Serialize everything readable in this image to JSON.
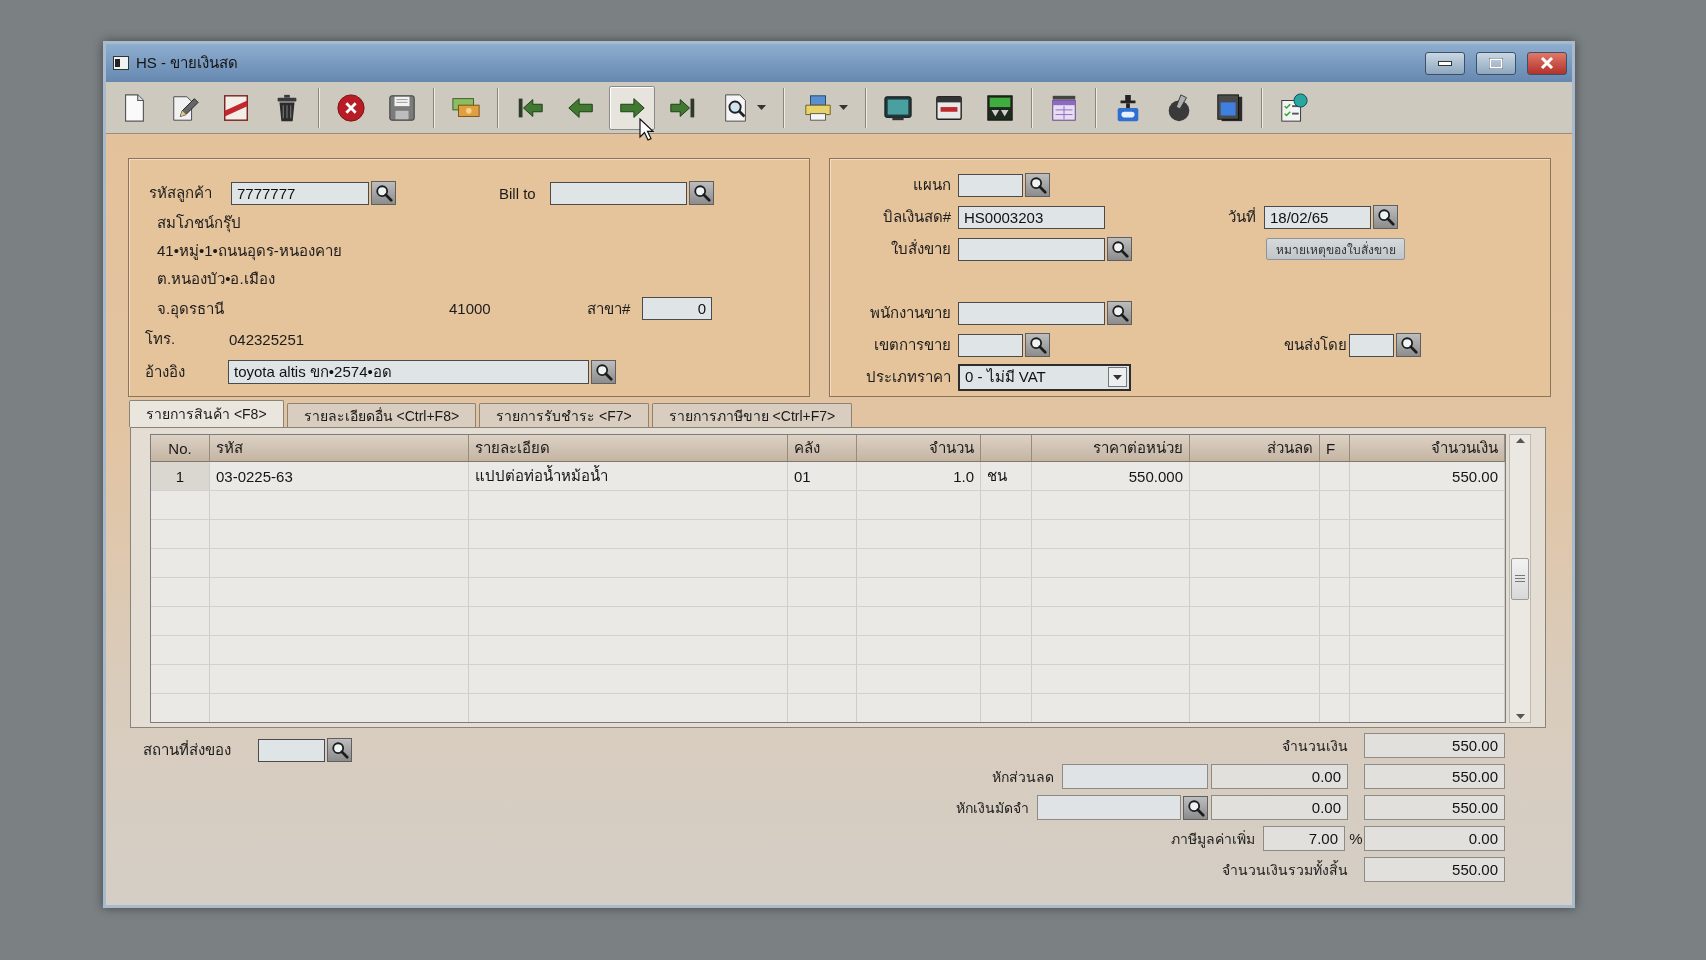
{
  "window": {
    "title": "HS - ขายเงินสด"
  },
  "toolbar": [
    [
      {
        "kind": "new",
        "hover": false,
        "dropdown": false
      },
      {
        "kind": "edit",
        "hover": false,
        "dropdown": false
      },
      {
        "kind": "void",
        "hover": false,
        "dropdown": false
      },
      {
        "kind": "delete",
        "hover": false,
        "dropdown": false
      }
    ],
    [
      {
        "kind": "cancel",
        "hover": false,
        "dropdown": false
      },
      {
        "kind": "save",
        "hover": false,
        "dropdown": false
      }
    ],
    [
      {
        "kind": "payment",
        "hover": false,
        "dropdown": false
      }
    ],
    [
      {
        "kind": "first",
        "hover": false,
        "dropdown": false
      },
      {
        "kind": "previous",
        "hover": false,
        "dropdown": false
      },
      {
        "kind": "next",
        "hover": true,
        "dropdown": false
      },
      {
        "kind": "last",
        "hover": false,
        "dropdown": false
      },
      {
        "kind": "find",
        "hover": false,
        "dropdown": true
      }
    ],
    [
      {
        "kind": "print",
        "hover": false,
        "dropdown": true
      }
    ],
    [
      {
        "kind": "monitor",
        "hover": false,
        "dropdown": false
      },
      {
        "kind": "card",
        "hover": false,
        "dropdown": false
      },
      {
        "kind": "transfer",
        "hover": false,
        "dropdown": false
      }
    ],
    [
      {
        "kind": "calendar",
        "hover": false,
        "dropdown": false
      }
    ],
    [
      {
        "kind": "stamp",
        "hover": false,
        "dropdown": false
      },
      {
        "kind": "pen",
        "hover": false,
        "dropdown": false
      },
      {
        "kind": "document",
        "hover": false,
        "dropdown": false
      }
    ],
    [
      {
        "kind": "checklist",
        "hover": false,
        "dropdown": false
      }
    ]
  ],
  "customer": {
    "code": {
      "label": "รหัสลูกค้า",
      "value": "7777777"
    },
    "bill_to": {
      "label": "Bill to"
    },
    "name": "สมโภชน์กรุ๊ป",
    "address": [
      "41•หมู่•1•ถนนอุดร-หนองคาย",
      "ต.หนองบัว•อ.เมือง",
      "จ.อุดรธานี"
    ],
    "postcode": "41000",
    "branch": {
      "label": "สาขา#",
      "value": "0"
    },
    "phone": {
      "label": "โทร.",
      "value": "042325251"
    },
    "reference": {
      "label": "อ้างอิง",
      "value": "toyota altis ขก•2574•อด"
    }
  },
  "document": {
    "department": {
      "label": "แผนก"
    },
    "cash_bill": {
      "label": "บิลเงินสด#",
      "value": "HS0003203"
    },
    "date": {
      "label": "วันที่",
      "value": "18/02/65"
    },
    "sales_order": {
      "label": "ใบสั่งขาย"
    },
    "order_note_button": "หมายเหตุของใบสั่งขาย",
    "salesperson": {
      "label": "พนักงานขาย"
    },
    "sales_area": {
      "label": "เขตการขาย"
    },
    "shipped_by": {
      "label": "ขนส่งโดย"
    },
    "price_type": {
      "label": "ประเภทราคา",
      "value": "0 - ไม่มี VAT"
    }
  },
  "tabs": [
    {
      "label": "รายการสินค้า <F8>",
      "selected": true
    },
    {
      "label": "รายละเอียดอื่น <Ctrl+F8>",
      "selected": false
    },
    {
      "label": "รายการรับชำระ <F7>",
      "selected": false
    },
    {
      "label": "รายการภาษีขาย <Ctrl+F7>",
      "selected": false
    }
  ],
  "table": {
    "columns": [
      "No.",
      "รหัส",
      "รายละเอียด",
      "คลัง",
      "จำนวน",
      "ราคาต่อหน่วย",
      "ส่วนลด",
      "F",
      "จำนวนเงิน"
    ],
    "rows": [
      {
        "no": "1",
        "code": "03-0225-63",
        "description": "แปปต่อท่อน้ำหม้อน้ำ",
        "warehouse": "01",
        "quantity": "1.0",
        "unit": "ชน",
        "unit_price": "550.000",
        "amount": "550.00"
      }
    ]
  },
  "delivery_place": {
    "label": "สถานที่ส่งของ"
  },
  "totals": [
    {
      "kind": "total",
      "label": "จำนวนเงิน",
      "value": "550.00"
    },
    {
      "kind": "deduction",
      "label": "หักส่วนลด",
      "search": false,
      "amount": "0.00",
      "value": "550.00"
    },
    {
      "kind": "deduction",
      "label": "หักเงินมัดจำ",
      "search": true,
      "amount": "0.00",
      "value": "550.00"
    },
    {
      "kind": "vat",
      "label": "ภาษีมูลค่าเพิ่ม",
      "rate": "7.00",
      "unit": "%",
      "value": "0.00"
    },
    {
      "kind": "total",
      "label": "จำนวนเงินรวมทั้งสิ้น",
      "value": "550.00"
    }
  ]
}
